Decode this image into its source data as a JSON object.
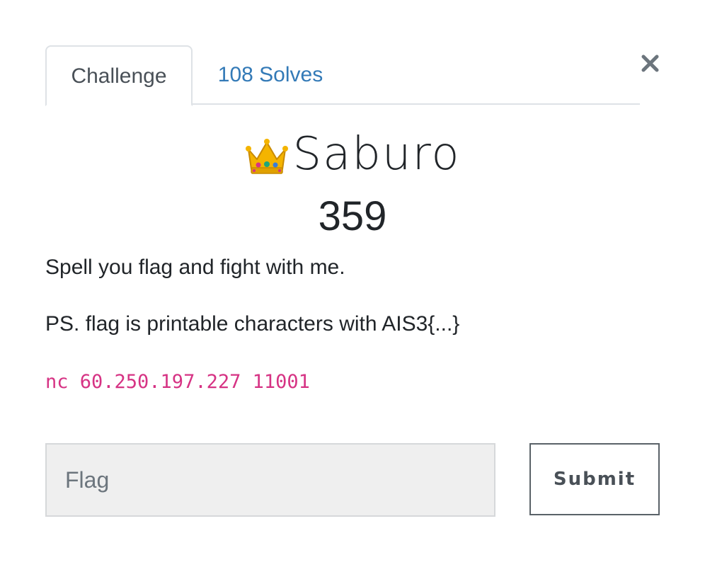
{
  "tabs": [
    {
      "label": "Challenge",
      "active": true
    },
    {
      "label": "108 Solves",
      "active": false
    }
  ],
  "close": {
    "icon": "close-icon",
    "glyph": "×"
  },
  "challenge": {
    "icon": "crown-icon",
    "name": "Saburo",
    "value": "359",
    "description": [
      "Spell you flag and fight with me.",
      "PS. flag is printable characters with AIS3{...}"
    ],
    "connection": "nc 60.250.197.227 11001"
  },
  "form": {
    "flag_placeholder": "Flag",
    "flag_value": "",
    "submit_label": "Submit"
  },
  "colors": {
    "link": "#337ab7",
    "code": "#d63384",
    "input_bg": "#efefef"
  }
}
